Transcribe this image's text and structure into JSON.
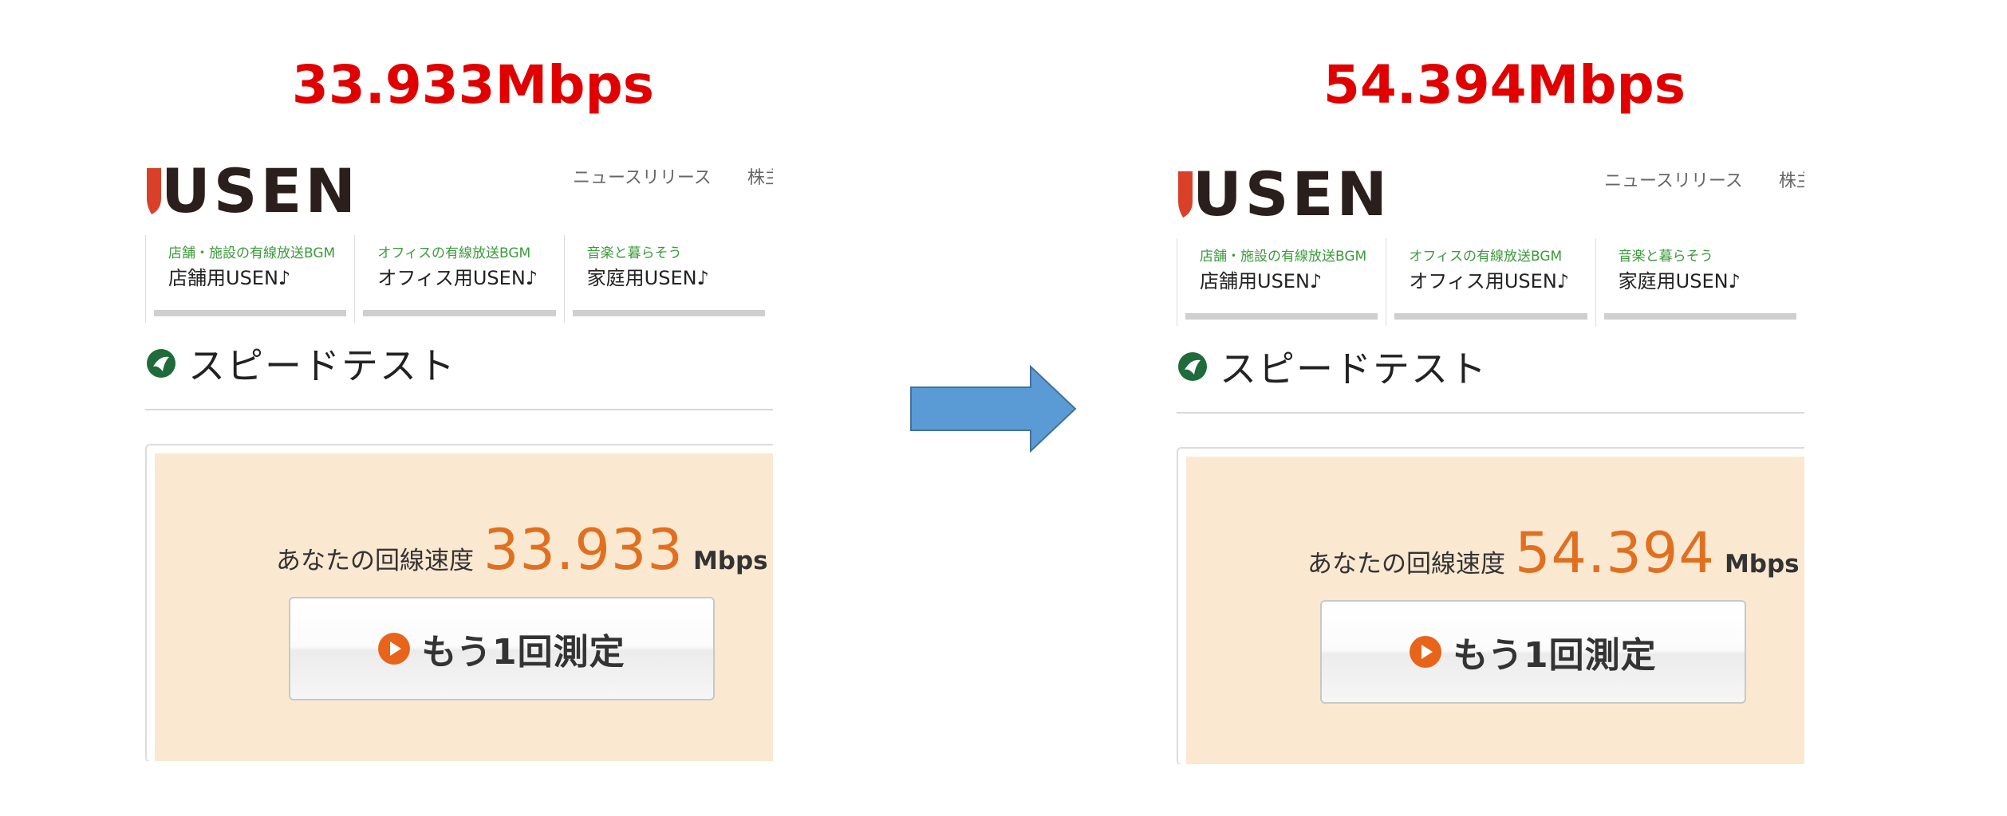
{
  "comparison": {
    "before": {
      "headline": "33.933Mbps",
      "page": {
        "logo": "USEN",
        "top_links": [
          "ニュースリリース",
          "株主"
        ],
        "nav": [
          {
            "sub": "店舗・施設の有線放送BGM",
            "main": "店舗用USEN♪"
          },
          {
            "sub": "オフィスの有線放送BGM",
            "main": "オフィス用USEN♪"
          },
          {
            "sub": "音楽と暮らそう",
            "main": "家庭用USEN♪"
          }
        ],
        "section_title": "スピードテスト",
        "speed_label": "あなたの回線速度",
        "speed_value": "33.933",
        "speed_unit": "Mbps",
        "retest_button": "もう1回測定"
      }
    },
    "after": {
      "headline": "54.394Mbps",
      "page": {
        "logo": "USEN",
        "top_links": [
          "ニュースリリース",
          "株主"
        ],
        "nav": [
          {
            "sub": "店舗・施設の有線放送BGM",
            "main": "店舗用USEN♪"
          },
          {
            "sub": "オフィスの有線放送BGM",
            "main": "オフィス用USEN♪"
          },
          {
            "sub": "音楽と暮らそう",
            "main": "家庭用USEN♪"
          }
        ],
        "section_title": "スピードテスト",
        "speed_label": "あなたの回線速度",
        "speed_value": "54.394",
        "speed_unit": "Mbps",
        "retest_button": "もう1回測定"
      }
    }
  },
  "colors": {
    "headline": "#e00000",
    "speed_value": "#e07020",
    "result_bg": "#fbe8d1",
    "arrow": "#5b9bd5",
    "nav_sub": "#3c9a3c",
    "logo_accent": "#d9402a"
  },
  "icons": {
    "arrow": "right-arrow-icon",
    "title": "usen-leaf-icon",
    "button": "play-circle-icon"
  }
}
